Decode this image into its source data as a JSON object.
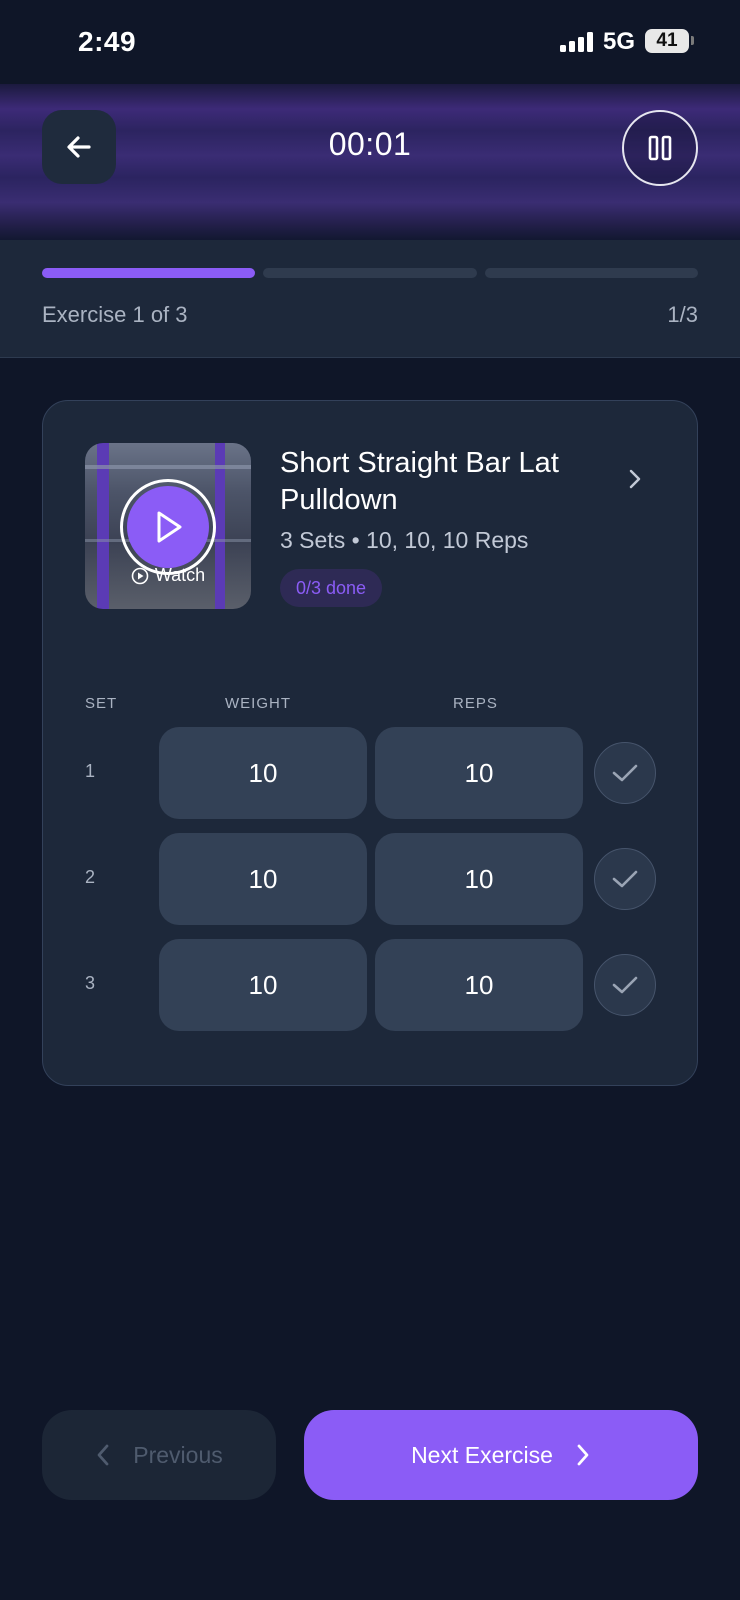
{
  "status_bar": {
    "time": "2:49",
    "network": "5G",
    "battery": "41"
  },
  "header": {
    "timer": "00:01"
  },
  "progress": {
    "label": "Exercise 1 of 3",
    "fraction": "1/3",
    "total_segments": 3,
    "completed_segments": 1,
    "accent_color": "#8b5cf6"
  },
  "exercise": {
    "title": "Short Straight Bar Lat Pulldown",
    "meta": "3 Sets • 10, 10, 10 Reps",
    "done_label": "0/3 done",
    "watch_label": "Watch"
  },
  "table": {
    "headers": {
      "set": "SET",
      "weight": "WEIGHT",
      "reps": "REPS"
    },
    "rows": [
      {
        "set": "1",
        "weight": "10",
        "reps": "10"
      },
      {
        "set": "2",
        "weight": "10",
        "reps": "10"
      },
      {
        "set": "3",
        "weight": "10",
        "reps": "10"
      }
    ]
  },
  "footer": {
    "previous_label": "Previous",
    "next_label": "Next Exercise"
  },
  "icons": {
    "back": "arrow-left-icon",
    "pause": "pause-icon",
    "play": "play-icon",
    "chevron": "chevron-right-icon",
    "check": "check-icon"
  }
}
